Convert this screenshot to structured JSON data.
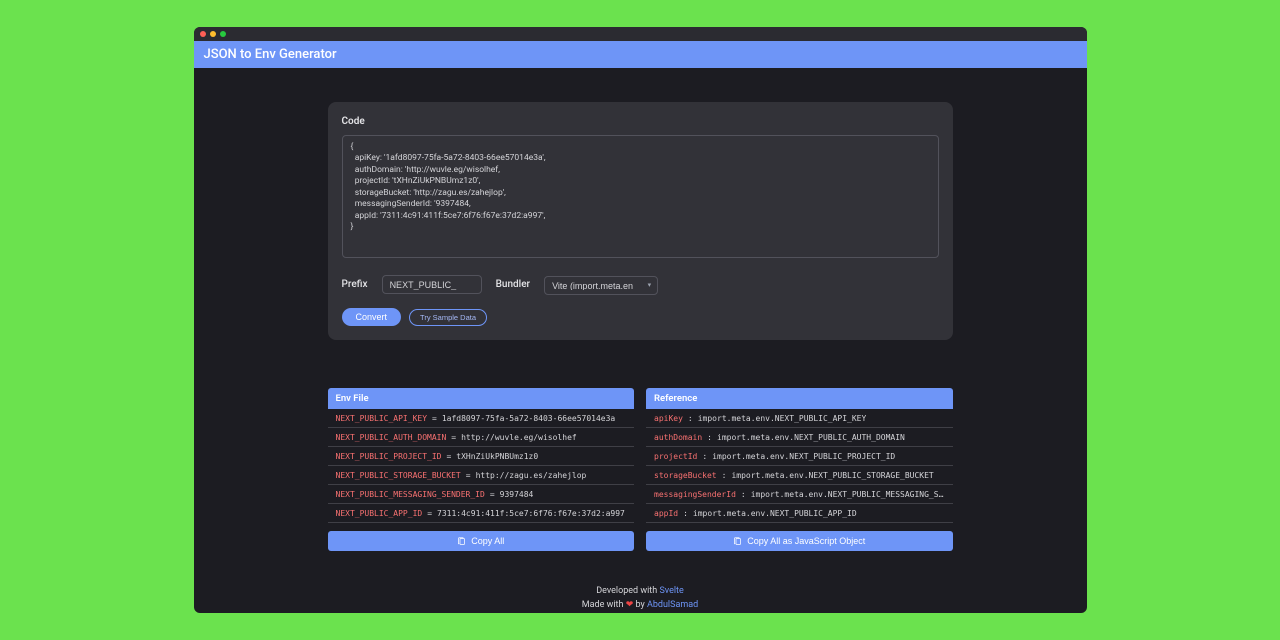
{
  "header": {
    "title": "JSON to Env Generator"
  },
  "card": {
    "code_label": "Code",
    "code_value": "{\n  apiKey: '1afd8097-75fa-5a72-8403-66ee57014e3a',\n  authDomain: 'http://wuvle.eg/wisolhef,\n  projectId: 'tXHnZiUkPNBUmz1z0',\n  storageBucket: 'http://zagu.es/zahejlop',\n  messagingSenderId: '9397484,\n  appId: '7311:4c91:411f:5ce7:6f76:f67e:37d2:a997',\n}",
    "prefix_label": "Prefix",
    "prefix_value": "NEXT_PUBLIC_",
    "bundler_label": "Bundler",
    "bundler_value": "Vite (import.meta.env)",
    "convert_label": "Convert",
    "sample_label": "Try Sample Data"
  },
  "envfile": {
    "title": "Env File",
    "rows": [
      {
        "key": "NEXT_PUBLIC_API_KEY",
        "eq": "=",
        "val": "1afd8097-75fa-5a72-8403-66ee57014e3a"
      },
      {
        "key": "NEXT_PUBLIC_AUTH_DOMAIN",
        "eq": "=",
        "val": "http://wuvle.eg/wisolhef"
      },
      {
        "key": "NEXT_PUBLIC_PROJECT_ID",
        "eq": "=",
        "val": "tXHnZiUkPNBUmz1z0"
      },
      {
        "key": "NEXT_PUBLIC_STORAGE_BUCKET",
        "eq": "=",
        "val": "http://zagu.es/zahejlop"
      },
      {
        "key": "NEXT_PUBLIC_MESSAGING_SENDER_ID",
        "eq": "=",
        "val": "9397484"
      },
      {
        "key": "NEXT_PUBLIC_APP_ID",
        "eq": "=",
        "val": "7311:4c91:411f:5ce7:6f76:f67e:37d2:a997"
      }
    ],
    "copy_label": "Copy All"
  },
  "reference": {
    "title": "Reference",
    "rows": [
      {
        "key": "apiKey",
        "eq": ":",
        "val": "import.meta.env.NEXT_PUBLIC_API_KEY"
      },
      {
        "key": "authDomain",
        "eq": ":",
        "val": "import.meta.env.NEXT_PUBLIC_AUTH_DOMAIN"
      },
      {
        "key": "projectId",
        "eq": ":",
        "val": "import.meta.env.NEXT_PUBLIC_PROJECT_ID"
      },
      {
        "key": "storageBucket",
        "eq": ":",
        "val": "import.meta.env.NEXT_PUBLIC_STORAGE_BUCKET"
      },
      {
        "key": "messagingSenderId",
        "eq": ":",
        "val": "import.meta.env.NEXT_PUBLIC_MESSAGING_SENDER_…"
      },
      {
        "key": "appId",
        "eq": ":",
        "val": "import.meta.env.NEXT_PUBLIC_APP_ID"
      }
    ],
    "copy_label": "Copy All as JavaScript Object"
  },
  "footer": {
    "dev_prefix": "Developed with ",
    "dev_link": "Svelte",
    "made_prefix": "Made with ",
    "heart": "❤",
    "by": " by ",
    "author": "AbdulSamad"
  }
}
